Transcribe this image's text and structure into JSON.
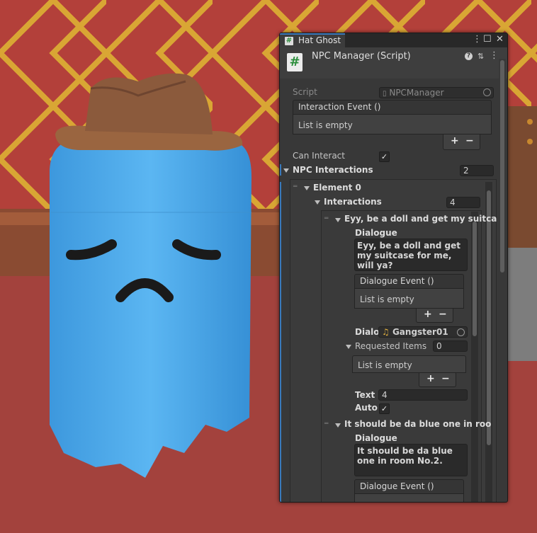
{
  "window": {
    "tab_title": "Hat Ghost",
    "tab_icon": "#",
    "menu_glyph": "⋮",
    "maximize_glyph": "☐",
    "close_glyph": "✕"
  },
  "component": {
    "title": "NPC Manager (Script)",
    "help_glyph": "?",
    "presets_glyph": "⇅",
    "menu_glyph": "⋮",
    "script_label": "Script",
    "script_value": "NPCManager",
    "interaction_event_label": "Interaction Event ()",
    "interaction_event_empty": "List is empty",
    "can_interact_label": "Can Interact",
    "can_interact_checked": "✓",
    "npc_interactions_label": "NPC Interactions",
    "npc_interactions_count": "2"
  },
  "element0": {
    "label": "Element 0",
    "interactions_label": "Interactions",
    "interactions_count": "4"
  },
  "interaction0": {
    "header": "Eyy, be a doll and get my suitca",
    "dialogue_label": "Dialogue",
    "dialogue_text": "Eyy, be a doll and get my suitcase for me, will ya?",
    "dialogue_event_label": "Dialogue Event ()",
    "dialogue_event_empty": "List is empty",
    "audio_label": "Dialo",
    "audio_value": "Gangster01",
    "requested_items_label": "Requested Items",
    "requested_items_count": "0",
    "requested_items_empty": "List is empty",
    "text_speed_label": "Text S",
    "text_speed_value": "4",
    "auto_label": "Auto",
    "auto_checked": "✓"
  },
  "interaction1": {
    "header": "It should be da blue one in roo",
    "dialogue_label": "Dialogue",
    "dialogue_text": "It should be da blue one in room No.2.",
    "dialogue_event_label": "Dialogue Event ()"
  },
  "list_controls": {
    "plus": "+",
    "minus": "−"
  },
  "colors": {
    "accent": "#3a79bb",
    "panel_bg": "#383838",
    "ghost": "#4aa8e8",
    "wall": "#b03a35"
  }
}
